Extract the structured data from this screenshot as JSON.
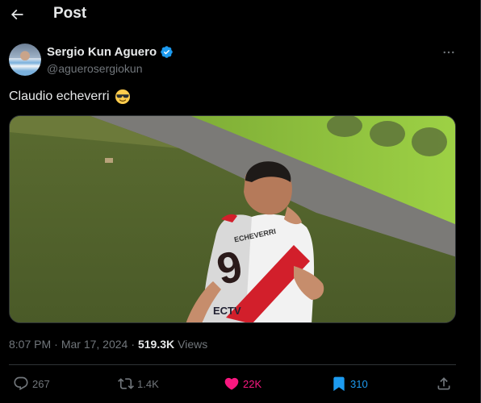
{
  "header": {
    "title": "Post"
  },
  "author": {
    "name": "Sergio Kun Aguero",
    "handle": "@aguerosergiokun"
  },
  "tweet": {
    "text": "Claudio echeverri",
    "emoji": "smiling-face-with-sunglasses"
  },
  "media": {
    "jersey_text": "ECTV"
  },
  "meta": {
    "time": "8:07 PM",
    "separator1": "·",
    "date": "Mar 17, 2024",
    "separator2": "·",
    "views_count": "519.3K",
    "views_label": "Views"
  },
  "actions": {
    "replies": "267",
    "reposts": "1.4K",
    "likes": "22K",
    "bookmarks": "310"
  },
  "colors": {
    "background": "#000000",
    "text": "#e7e9ea",
    "muted": "#71767b",
    "like": "#f91880",
    "bookmark": "#1d9bf0",
    "verified": "#1d9bf0"
  }
}
